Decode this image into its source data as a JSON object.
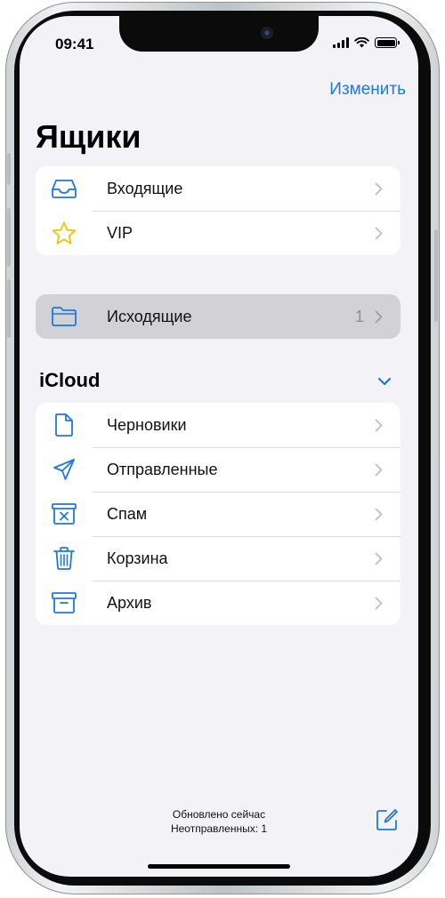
{
  "status_bar": {
    "time": "09:41"
  },
  "header": {
    "edit_label": "Изменить",
    "title": "Ящики"
  },
  "mailboxes": [
    {
      "label": "Входящие",
      "icon": "inbox-icon"
    },
    {
      "label": "VIP",
      "icon": "star-icon"
    }
  ],
  "outbox": {
    "label": "Исходящие",
    "count": "1",
    "icon": "folder-icon"
  },
  "icloud": {
    "title": "iCloud",
    "items": [
      {
        "label": "Черновики",
        "icon": "document-icon"
      },
      {
        "label": "Отправленные",
        "icon": "paper-plane-icon"
      },
      {
        "label": "Спам",
        "icon": "junk-bin-icon"
      },
      {
        "label": "Корзина",
        "icon": "trash-icon"
      },
      {
        "label": "Архив",
        "icon": "archive-box-icon"
      }
    ]
  },
  "footer": {
    "updated": "Обновлено сейчас",
    "unsent": "Неотправленных: 1"
  },
  "colors": {
    "accent": "#1f77e2",
    "background": "#f2f2f7",
    "selected_row": "#d1d1d6",
    "chevron": "#c4c4c7",
    "star": "#f7d400"
  }
}
